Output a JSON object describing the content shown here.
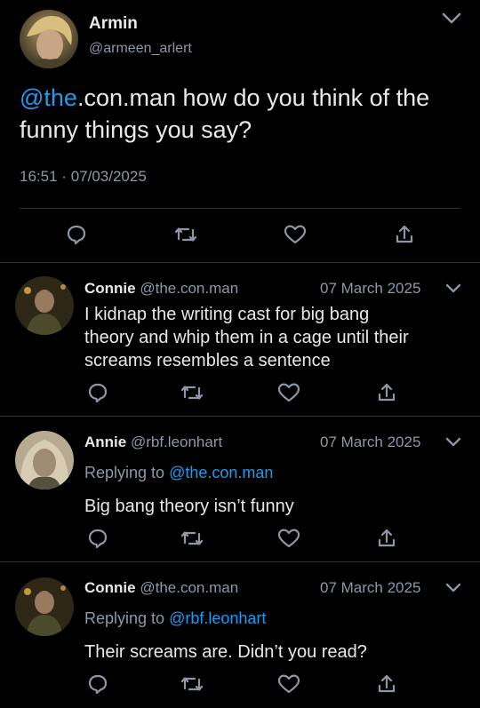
{
  "main_tweet": {
    "name": "Armin",
    "handle": "@armeen_arlert",
    "mention": "@the",
    "text_line1_rest": ".con.man how do you think of the",
    "text_line2": "funny things you say?",
    "time": "16:51",
    "separator": "·",
    "date": "07/03/2025"
  },
  "replies": [
    {
      "name": "Connie",
      "handle": "@the.con.man",
      "date": "07 March 2025",
      "lines": [
        "I kidnap the writing cast for big bang",
        "theory and whip them in a cage until their",
        "screams resembles a sentence"
      ]
    },
    {
      "name": "Annie",
      "handle": "@rbf.leonhart",
      "date": "07 March 2025",
      "replying_to_label": "Replying to",
      "replying_to_handle": "@the.con.man",
      "lines": [
        "Big bang theory isn’t funny"
      ]
    },
    {
      "name": "Connie",
      "handle": "@the.con.man",
      "date": "07 March 2025",
      "replying_to_label": "Replying to",
      "replying_to_handle": "@rbf.leonhart",
      "lines": [
        "Their screams are. Didn’t you read?"
      ]
    }
  ],
  "icons": [
    "reply-icon",
    "retweet-icon",
    "like-icon",
    "share-icon",
    "chevron-down-icon"
  ],
  "colors": {
    "background": "#000000",
    "text": "#e7e9ea",
    "muted": "#8b98a5",
    "link": "#1d9bf0",
    "divider": "#2f3336"
  }
}
